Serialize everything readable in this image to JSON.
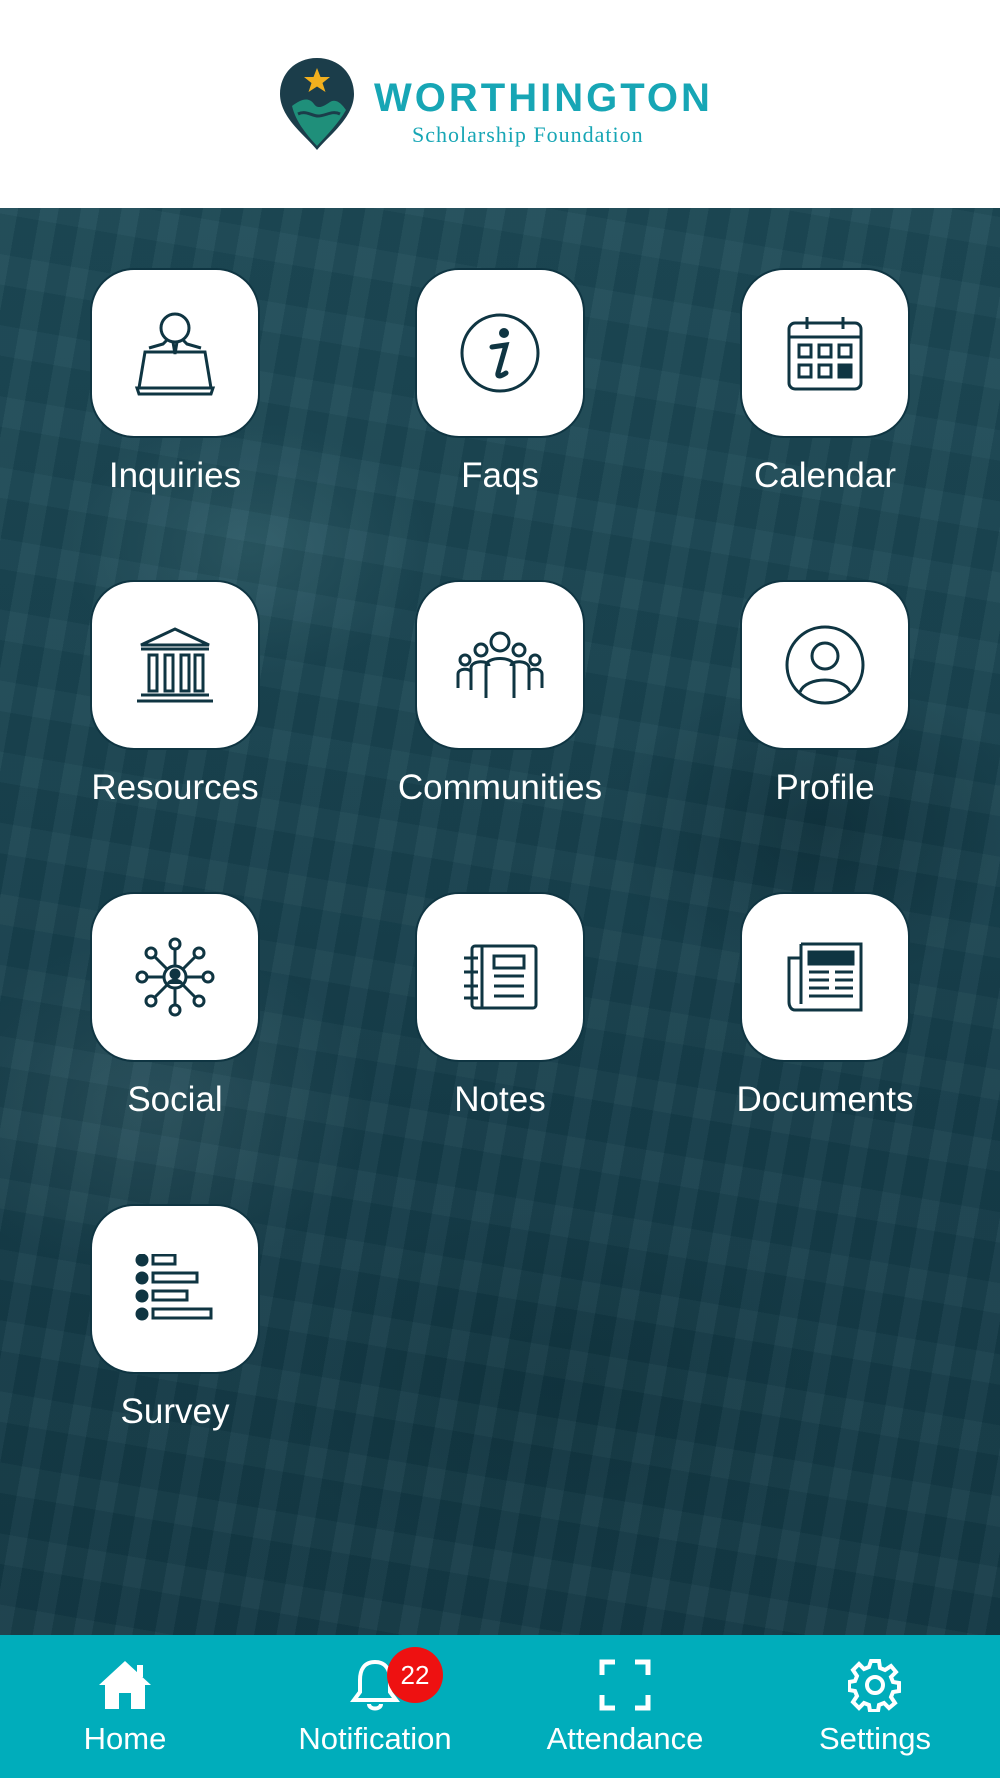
{
  "brand": {
    "name": "WORTHINGTON",
    "subtitle": "Scholarship Foundation",
    "color": "#17a6b5",
    "pin_color": "#1b3d4a",
    "star_color": "#f2b01e"
  },
  "tiles": [
    {
      "label": "Inquiries",
      "icon": "person-laptop-icon"
    },
    {
      "label": "Faqs",
      "icon": "info-icon"
    },
    {
      "label": "Calendar",
      "icon": "calendar-icon"
    },
    {
      "label": "Resources",
      "icon": "bank-building-icon"
    },
    {
      "label": "Communities",
      "icon": "people-group-icon"
    },
    {
      "label": "Profile",
      "icon": "user-circle-icon"
    },
    {
      "label": "Social",
      "icon": "network-hub-icon"
    },
    {
      "label": "Notes",
      "icon": "notebook-icon"
    },
    {
      "label": "Documents",
      "icon": "newspaper-icon"
    },
    {
      "label": "Survey",
      "icon": "list-bars-icon"
    }
  ],
  "nav": [
    {
      "label": "Home",
      "icon": "home-icon"
    },
    {
      "label": "Notification",
      "icon": "bell-icon",
      "badge": "22"
    },
    {
      "label": "Attendance",
      "icon": "scan-frame-icon"
    },
    {
      "label": "Settings",
      "icon": "gear-icon"
    }
  ],
  "colors": {
    "nav_background": "#00adbb",
    "badge": "#ee1111",
    "tile_icon": "#0f3542",
    "overlay": "#1a4552"
  }
}
